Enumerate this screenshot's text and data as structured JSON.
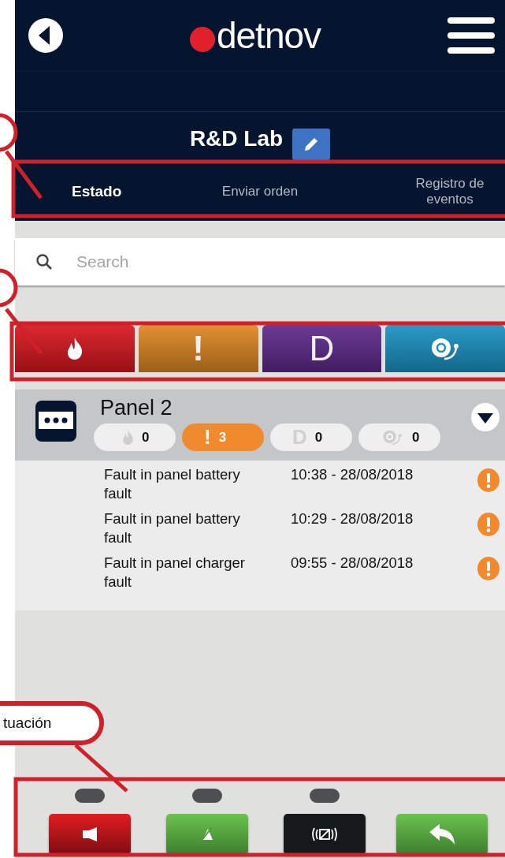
{
  "header": {
    "logo": "detnov"
  },
  "site": {
    "title": "R&D Lab"
  },
  "tabs": [
    {
      "label": "Estado",
      "selected": true
    },
    {
      "label": "Enviar orden",
      "selected": false
    },
    {
      "label": "Registro de eventos",
      "selected": false
    }
  ],
  "search": {
    "placeholder": "Search"
  },
  "filters": [
    {
      "kind": "fire",
      "color": "#d8171e"
    },
    {
      "kind": "fault",
      "glyph": "!",
      "color": "#e08722"
    },
    {
      "kind": "disable",
      "glyph": "D",
      "color": "#5e2a8c"
    },
    {
      "kind": "bell",
      "color": "#1a93c4"
    }
  ],
  "panel": {
    "name": "Panel 2",
    "counters": [
      {
        "kind": "fire",
        "count": "0",
        "active": false
      },
      {
        "kind": "fault",
        "glyph": "!",
        "count": "3",
        "active": true
      },
      {
        "kind": "disable",
        "glyph": "D",
        "count": "0",
        "active": false
      },
      {
        "kind": "bell",
        "count": "0",
        "active": false
      }
    ],
    "events": [
      {
        "text": "Fault in panel battery fault",
        "time": "10:38 - 28/08/2018"
      },
      {
        "text": "Fault in panel battery fault",
        "time": "10:29 - 28/08/2018"
      },
      {
        "text": "Fault in panel charger fault",
        "time": "09:55 - 28/08/2018"
      }
    ]
  },
  "actions": [
    {
      "kind": "siren",
      "led": true
    },
    {
      "kind": "mute",
      "led": true
    },
    {
      "kind": "reset",
      "led": true
    },
    {
      "kind": "back",
      "led": false
    }
  ],
  "annotations": [
    {
      "kind": "callout",
      "text": "tuación"
    }
  ]
}
